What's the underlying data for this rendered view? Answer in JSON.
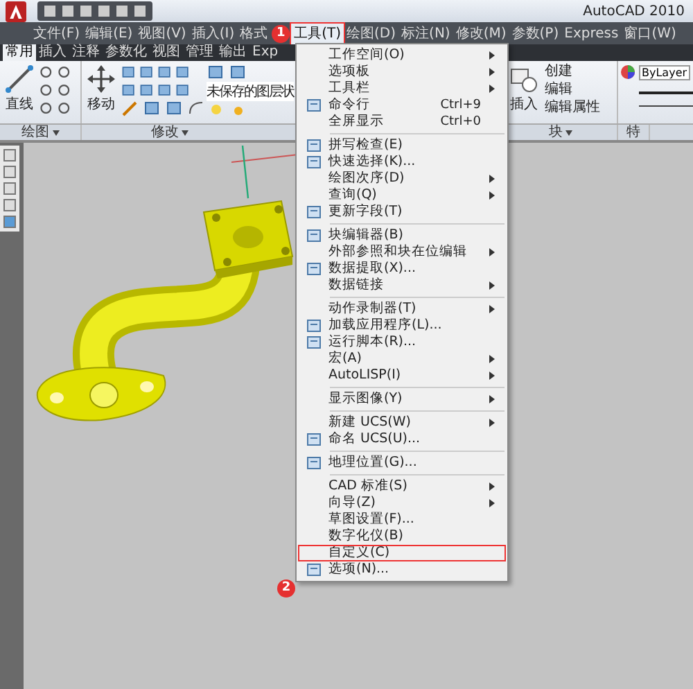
{
  "title_bar": {
    "title": "AutoCAD 2010"
  },
  "menu_bar": [
    {
      "label": "文件(F)",
      "selected": false
    },
    {
      "label": "编辑(E)",
      "selected": false
    },
    {
      "label": "视图(V)",
      "selected": false
    },
    {
      "label": "插入(I)",
      "selected": false
    },
    {
      "label": "格式",
      "selected": false
    },
    {
      "label": "工具(T)",
      "selected": true,
      "marked": true
    },
    {
      "label": "绘图(D)",
      "selected": false
    },
    {
      "label": "标注(N)",
      "selected": false
    },
    {
      "label": "修改(M)",
      "selected": false
    },
    {
      "label": "参数(P)",
      "selected": false
    },
    {
      "label": "Express",
      "selected": false
    },
    {
      "label": "窗口(W)",
      "selected": false
    }
  ],
  "ribbon": {
    "tabs": [
      {
        "label": "常用",
        "selected": true
      },
      {
        "label": "插入",
        "selected": false
      },
      {
        "label": "注释",
        "selected": false
      },
      {
        "label": "参数化",
        "selected": false
      },
      {
        "label": "视图",
        "selected": false
      },
      {
        "label": "管理",
        "selected": false
      },
      {
        "label": "输出",
        "selected": false
      },
      {
        "label": "Exp",
        "selected": false
      }
    ],
    "draw_panel": {
      "line_tool": "直线",
      "label": "绘图"
    },
    "modify_panel": {
      "move_tool": "移动",
      "layer_state": "未保存的图层状",
      "label": "修改"
    },
    "block_panel": {
      "insert_tool": "插入",
      "tools": [
        "创建",
        "编辑",
        "编辑属性"
      ],
      "label": "块"
    },
    "properties_panel": {
      "layer": "ByLayer",
      "label": "特"
    }
  },
  "tools_menu": {
    "groups": [
      [
        {
          "label": "工作空间(O)",
          "submenu": true
        },
        {
          "label": "选项板",
          "submenu": true
        },
        {
          "label": "工具栏",
          "submenu": true
        },
        {
          "label": "命令行",
          "shortcut": "Ctrl+9",
          "icon": true
        },
        {
          "label": "全屏显示",
          "shortcut": "Ctrl+0"
        }
      ],
      [
        {
          "label": "拼写检查(E)",
          "icon": true
        },
        {
          "label": "快速选择(K)...",
          "icon": true
        },
        {
          "label": "绘图次序(D)",
          "submenu": true
        },
        {
          "label": "查询(Q)",
          "submenu": true
        },
        {
          "label": "更新字段(T)",
          "icon": true
        }
      ],
      [
        {
          "label": "块编辑器(B)",
          "icon": true
        },
        {
          "label": "外部参照和块在位编辑",
          "submenu": true
        },
        {
          "label": "数据提取(X)...",
          "icon": true
        },
        {
          "label": "数据链接",
          "submenu": true
        }
      ],
      [
        {
          "label": "动作录制器(T)",
          "submenu": true
        },
        {
          "label": "加载应用程序(L)...",
          "icon": true
        },
        {
          "label": "运行脚本(R)...",
          "icon": true
        },
        {
          "label": "宏(A)",
          "submenu": true
        },
        {
          "label": "AutoLISP(I)",
          "submenu": true
        }
      ],
      [
        {
          "label": "显示图像(Y)",
          "submenu": true
        }
      ],
      [
        {
          "label": "新建 UCS(W)",
          "submenu": true
        },
        {
          "label": "命名 UCS(U)...",
          "icon": true
        }
      ],
      [
        {
          "label": "地理位置(G)...",
          "icon": true
        }
      ],
      [
        {
          "label": "CAD 标准(S)",
          "submenu": true
        },
        {
          "label": "向导(Z)",
          "submenu": true
        },
        {
          "label": "草图设置(F)..."
        },
        {
          "label": "数字化仪(B)"
        },
        {
          "label": "自定义(C)",
          "marked": true
        },
        {
          "label": "选项(N)...",
          "icon": true
        }
      ]
    ]
  },
  "annotations": [
    {
      "label": "1"
    },
    {
      "label": "2"
    }
  ]
}
